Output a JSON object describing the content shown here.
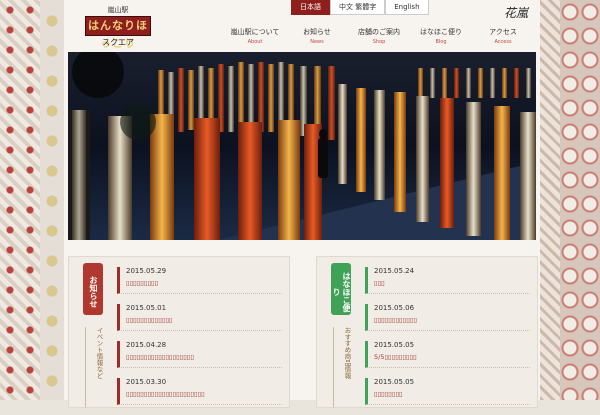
{
  "header": {
    "logo": {
      "top": "嵐山駅",
      "main": "はんなりほっこり",
      "bottom": "スクエア"
    },
    "brand": "花嵐",
    "languages": [
      "日本語",
      "中文 繁體字",
      "English"
    ],
    "active_language": "日本語",
    "nav": [
      {
        "jp": "嵐山駅について",
        "en": "About"
      },
      {
        "jp": "お知らせ",
        "en": "News"
      },
      {
        "jp": "店舗のご案内",
        "en": "Shop"
      },
      {
        "jp": "はなほこ便り",
        "en": "Blog"
      },
      {
        "jp": "アクセス",
        "en": "Access"
      }
    ]
  },
  "news": {
    "tag": "お知らせ",
    "subtag": "イベント情報など",
    "items": [
      {
        "date": "2015.05.29",
        "title": "▯▯▯▯▯▯▯▯▯"
      },
      {
        "date": "2015.05.01",
        "title": "▯▯▯▯▯▯▯▯▯▯▯▯▯"
      },
      {
        "date": "2015.04.28",
        "title": "▯▯▯▯▯▯▯▯▯▯▯▯▯▯▯▯▯▯▯"
      },
      {
        "date": "2015.03.30",
        "title": "▯▯▯▯▯▯▯▯▯▯▯▯▯▯▯▯▯▯▯▯▯▯"
      }
    ]
  },
  "blog": {
    "tag": "はなほこ便り",
    "subtag": "おすすめ商品情報",
    "items": [
      {
        "date": "2015.05.24",
        "title": "▯▯▯"
      },
      {
        "date": "2015.05.06",
        "title": "▯▯▯▯▯▯▯▯▯▯▯▯"
      },
      {
        "date": "2015.05.05",
        "title": "5/5▯▯▯▯▯▯▯▯▯"
      },
      {
        "date": "2015.05.05",
        "title": "▯▯▯▯▯▯▯▯"
      }
    ]
  },
  "colors": {
    "accent_red": "#8e1f1c",
    "accent_green": "#3fa257"
  }
}
